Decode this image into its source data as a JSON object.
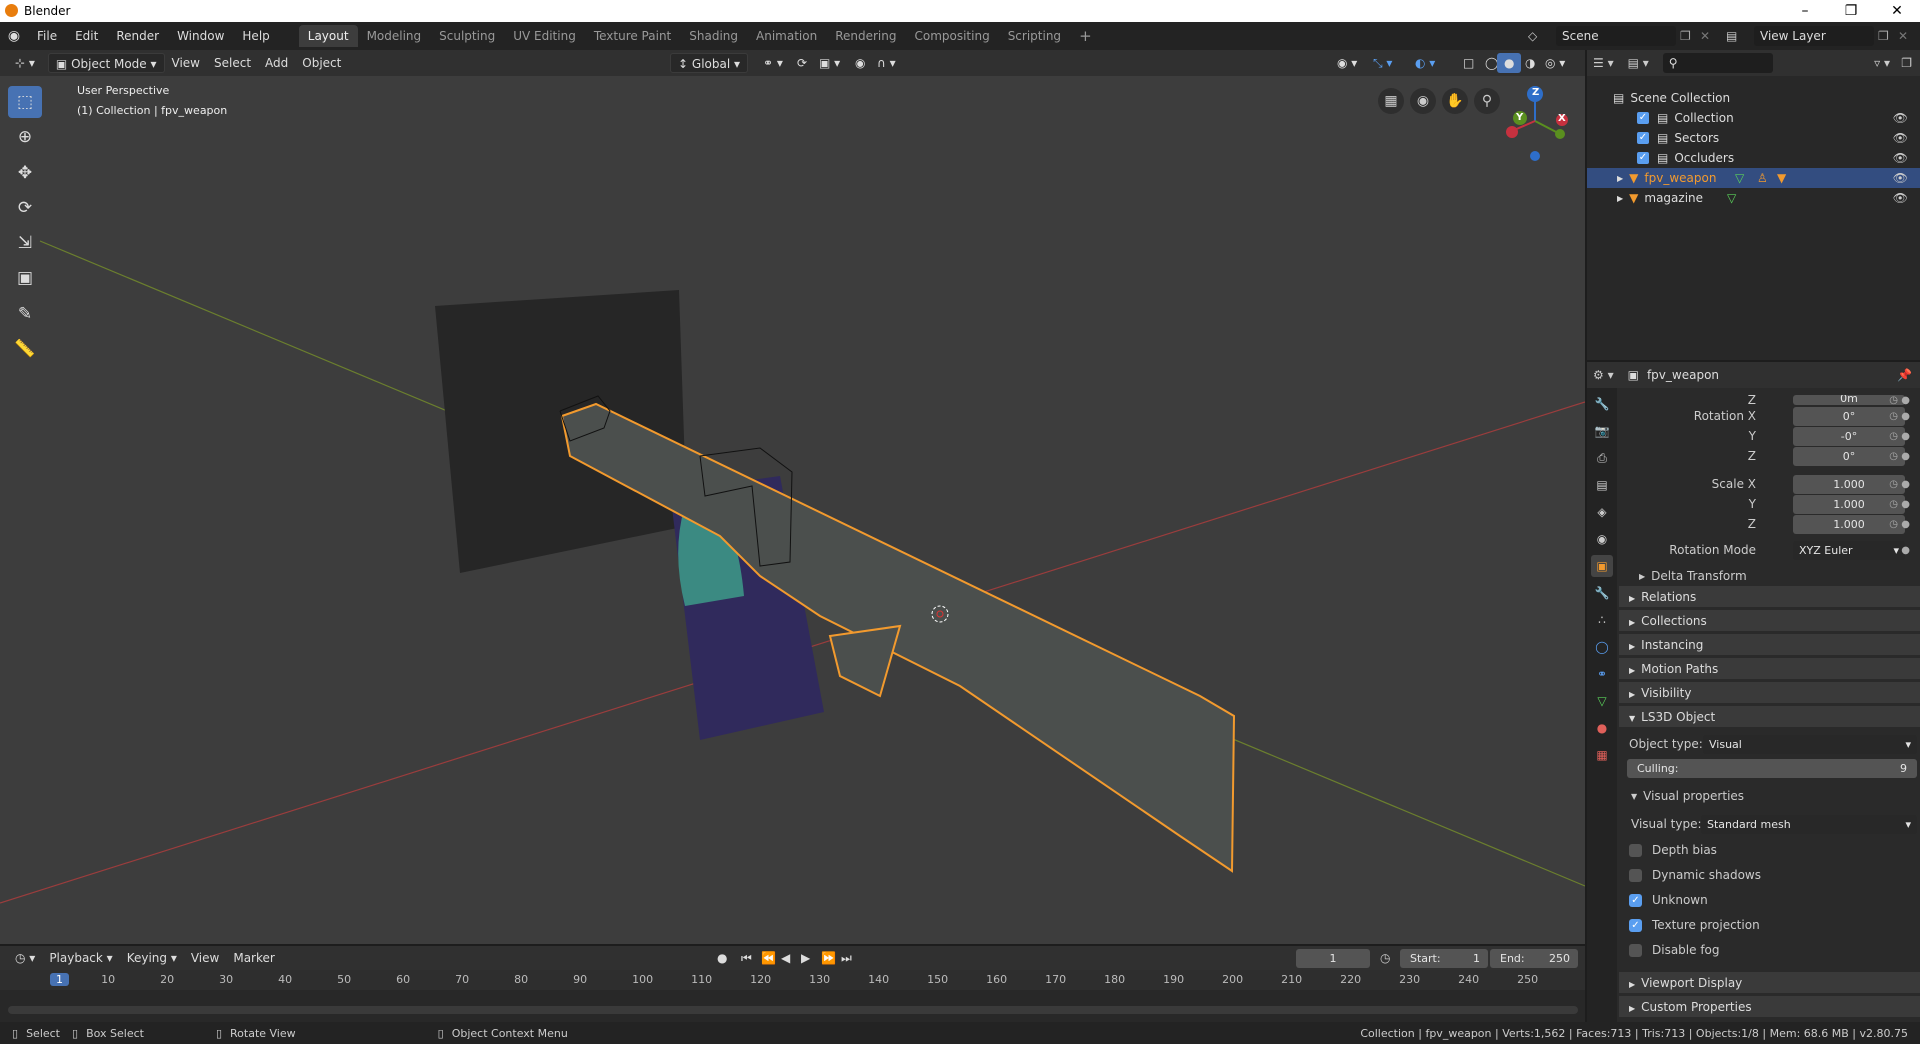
{
  "window": {
    "title": "Blender"
  },
  "menus": [
    "File",
    "Edit",
    "Render",
    "Window",
    "Help"
  ],
  "workspaces": [
    "Layout",
    "Modeling",
    "Sculpting",
    "UV Editing",
    "Texture Paint",
    "Shading",
    "Animation",
    "Rendering",
    "Compositing",
    "Scripting"
  ],
  "active_workspace": "Layout",
  "scene": {
    "name": "Scene",
    "view_layer": "View Layer"
  },
  "viewport_header": {
    "mode": "Object Mode",
    "menus": [
      "View",
      "Select",
      "Add",
      "Object"
    ],
    "orientation": "Global"
  },
  "viewport": {
    "perspective": "User Perspective",
    "collection_info": "(1) Collection | fpv_weapon"
  },
  "gizmo": {
    "x": "X",
    "y": "Y",
    "z": "Z"
  },
  "outliner": {
    "root": "Scene Collection",
    "items": [
      {
        "name": "Collection"
      },
      {
        "name": "Sectors"
      },
      {
        "name": "Occluders"
      },
      {
        "name": "fpv_weapon",
        "active": true
      },
      {
        "name": "magazine"
      }
    ]
  },
  "properties": {
    "object_name": "fpv_weapon",
    "rotation": {
      "label_x": "Rotation X",
      "label_y": "Y",
      "label_z": "Z",
      "x": "0°",
      "y": "-0°",
      "z": "0°"
    },
    "scale": {
      "label_x": "Scale X",
      "label_y": "Y",
      "label_z": "Z",
      "x": "1.000",
      "y": "1.000",
      "z": "1.000"
    },
    "location_z_partial": "0m",
    "location_z_label": "Z",
    "rotation_mode": {
      "label": "Rotation Mode",
      "value": "XYZ Euler"
    },
    "delta_transform": "Delta Transform",
    "panels": [
      "Relations",
      "Collections",
      "Instancing",
      "Motion Paths",
      "Visibility"
    ],
    "ls3d": {
      "title": "LS3D Object",
      "object_type_label": "Object type:",
      "object_type": "Visual",
      "culling_label": "Culling:",
      "culling_value": "9",
      "visual_props_title": "Visual properties",
      "visual_type_label": "Visual type:",
      "visual_type": "Standard mesh",
      "checkboxes": [
        {
          "label": "Depth bias",
          "checked": false
        },
        {
          "label": "Dynamic shadows",
          "checked": false
        },
        {
          "label": "Unknown",
          "checked": true
        },
        {
          "label": "Texture projection",
          "checked": true
        },
        {
          "label": "Disable fog",
          "checked": false
        }
      ]
    },
    "bottom_panels": [
      "Viewport Display",
      "Custom Properties"
    ]
  },
  "timeline": {
    "menus": [
      "Playback",
      "Keying",
      "View",
      "Marker"
    ],
    "current_frame": "1",
    "start_label": "Start:",
    "start": "1",
    "end_label": "End:",
    "end": "250",
    "ticks": [
      "1",
      "10",
      "20",
      "30",
      "40",
      "50",
      "60",
      "70",
      "80",
      "90",
      "100",
      "110",
      "120",
      "130",
      "140",
      "150",
      "160",
      "170",
      "180",
      "190",
      "200",
      "210",
      "220",
      "230",
      "240",
      "250"
    ]
  },
  "statusbar": {
    "select": "Select",
    "box_select": "Box Select",
    "rotate_view": "Rotate View",
    "context_menu": "Object Context Menu",
    "stats": "Collection | fpv_weapon | Verts:1,562 | Faces:713 | Tris:713 | Objects:1/8 | Mem: 68.6 MB | v2.80.75"
  }
}
